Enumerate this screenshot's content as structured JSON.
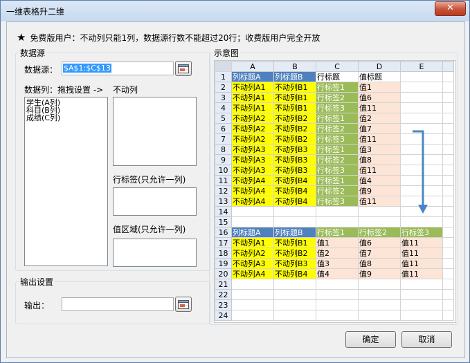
{
  "window": {
    "title": "一维表格升二维",
    "close_label": "✕"
  },
  "notice": {
    "icon": "star-icon",
    "text": "免费版用户：不动列只能1列，数据源行数不能超过20行；收费版用户完全开放"
  },
  "datasource": {
    "legend": "数据源",
    "source_label": "数据源：",
    "source_value": "$A$1:$C$13",
    "columns_label": "数据列：拖拽设置 ->",
    "columns": [
      "学生(A列)",
      "科目(B列)",
      "成绩(C列)"
    ],
    "fixed_label": "不动列",
    "rowtag_label": "行标签(只允许一列)",
    "value_label": "值区域(只允许一列)"
  },
  "output": {
    "legend": "输出设置",
    "label": "输出：",
    "value": ""
  },
  "diagram": {
    "legend": "示意图",
    "col_headers": [
      "A",
      "B",
      "C",
      "D",
      "E"
    ],
    "rows": [
      {
        "n": "1",
        "cells": [
          {
            "t": "列标题A",
            "c": "bh"
          },
          {
            "t": "列标题B",
            "c": "bh"
          },
          {
            "t": "行标题",
            "c": ""
          },
          {
            "t": "值标题",
            "c": ""
          },
          {
            "t": "",
            "c": ""
          }
        ]
      },
      {
        "n": "2",
        "cells": [
          {
            "t": "不动列A1",
            "c": "y"
          },
          {
            "t": "不动列B1",
            "c": "y"
          },
          {
            "t": "行标签1",
            "c": "g"
          },
          {
            "t": "值1",
            "c": "p"
          },
          {
            "t": "",
            "c": ""
          }
        ]
      },
      {
        "n": "3",
        "cells": [
          {
            "t": "不动列A1",
            "c": "y"
          },
          {
            "t": "不动列B1",
            "c": "y"
          },
          {
            "t": "行标签2",
            "c": "g"
          },
          {
            "t": "值6",
            "c": "p"
          },
          {
            "t": "",
            "c": ""
          }
        ]
      },
      {
        "n": "4",
        "cells": [
          {
            "t": "不动列A1",
            "c": "y"
          },
          {
            "t": "不动列B1",
            "c": "y"
          },
          {
            "t": "行标签3",
            "c": "g"
          },
          {
            "t": "值11",
            "c": "p"
          },
          {
            "t": "",
            "c": ""
          }
        ]
      },
      {
        "n": "5",
        "cells": [
          {
            "t": "不动列A2",
            "c": "y"
          },
          {
            "t": "不动列B2",
            "c": "y"
          },
          {
            "t": "行标签1",
            "c": "g"
          },
          {
            "t": "值2",
            "c": "p"
          },
          {
            "t": "",
            "c": ""
          }
        ]
      },
      {
        "n": "6",
        "cells": [
          {
            "t": "不动列A2",
            "c": "y"
          },
          {
            "t": "不动列B2",
            "c": "y"
          },
          {
            "t": "行标签2",
            "c": "g"
          },
          {
            "t": "值7",
            "c": "p"
          },
          {
            "t": "",
            "c": ""
          }
        ]
      },
      {
        "n": "7",
        "cells": [
          {
            "t": "不动列A2",
            "c": "y"
          },
          {
            "t": "不动列B2",
            "c": "y"
          },
          {
            "t": "行标签3",
            "c": "g"
          },
          {
            "t": "值11",
            "c": "p"
          },
          {
            "t": "",
            "c": ""
          }
        ]
      },
      {
        "n": "8",
        "cells": [
          {
            "t": "不动列A3",
            "c": "y"
          },
          {
            "t": "不动列B3",
            "c": "y"
          },
          {
            "t": "行标签1",
            "c": "g"
          },
          {
            "t": "值3",
            "c": "p"
          },
          {
            "t": "",
            "c": ""
          }
        ]
      },
      {
        "n": "9",
        "cells": [
          {
            "t": "不动列A3",
            "c": "y"
          },
          {
            "t": "不动列B3",
            "c": "y"
          },
          {
            "t": "行标签2",
            "c": "g"
          },
          {
            "t": "值8",
            "c": "p"
          },
          {
            "t": "",
            "c": ""
          }
        ]
      },
      {
        "n": "10",
        "cells": [
          {
            "t": "不动列A3",
            "c": "y"
          },
          {
            "t": "不动列B3",
            "c": "y"
          },
          {
            "t": "行标签3",
            "c": "g"
          },
          {
            "t": "值11",
            "c": "p"
          },
          {
            "t": "",
            "c": ""
          }
        ]
      },
      {
        "n": "11",
        "cells": [
          {
            "t": "不动列A4",
            "c": "y"
          },
          {
            "t": "不动列B4",
            "c": "y"
          },
          {
            "t": "行标签1",
            "c": "g"
          },
          {
            "t": "值4",
            "c": "p"
          },
          {
            "t": "",
            "c": ""
          }
        ]
      },
      {
        "n": "12",
        "cells": [
          {
            "t": "不动列A4",
            "c": "y"
          },
          {
            "t": "不动列B4",
            "c": "y"
          },
          {
            "t": "行标签2",
            "c": "g"
          },
          {
            "t": "值9",
            "c": "p"
          },
          {
            "t": "",
            "c": ""
          }
        ]
      },
      {
        "n": "13",
        "cells": [
          {
            "t": "不动列A4",
            "c": "y"
          },
          {
            "t": "不动列B4",
            "c": "y"
          },
          {
            "t": "行标签3",
            "c": "g"
          },
          {
            "t": "值11",
            "c": "p"
          },
          {
            "t": "",
            "c": ""
          }
        ]
      },
      {
        "n": "14",
        "cells": [
          {
            "t": "",
            "c": ""
          },
          {
            "t": "",
            "c": ""
          },
          {
            "t": "",
            "c": ""
          },
          {
            "t": "",
            "c": ""
          },
          {
            "t": "",
            "c": ""
          }
        ]
      },
      {
        "n": "15",
        "cells": [
          {
            "t": "",
            "c": ""
          },
          {
            "t": "",
            "c": ""
          },
          {
            "t": "",
            "c": ""
          },
          {
            "t": "",
            "c": ""
          },
          {
            "t": "",
            "c": ""
          }
        ]
      },
      {
        "n": "16",
        "cells": [
          {
            "t": "列标题A",
            "c": "bh"
          },
          {
            "t": "列标题B",
            "c": "bh"
          },
          {
            "t": "行标签1",
            "c": "gh"
          },
          {
            "t": "行标签2",
            "c": "gh"
          },
          {
            "t": "行标签3",
            "c": "gh"
          }
        ]
      },
      {
        "n": "17",
        "cells": [
          {
            "t": "不动列A1",
            "c": "y"
          },
          {
            "t": "不动列B1",
            "c": "y"
          },
          {
            "t": "值1",
            "c": "p"
          },
          {
            "t": "值6",
            "c": "p"
          },
          {
            "t": "值11",
            "c": "p"
          }
        ]
      },
      {
        "n": "18",
        "cells": [
          {
            "t": "不动列A2",
            "c": "y"
          },
          {
            "t": "不动列B2",
            "c": "y"
          },
          {
            "t": "值2",
            "c": "p"
          },
          {
            "t": "值7",
            "c": "p"
          },
          {
            "t": "值11",
            "c": "p"
          }
        ]
      },
      {
        "n": "19",
        "cells": [
          {
            "t": "不动列A3",
            "c": "y"
          },
          {
            "t": "不动列B3",
            "c": "y"
          },
          {
            "t": "值3",
            "c": "p"
          },
          {
            "t": "值8",
            "c": "p"
          },
          {
            "t": "值11",
            "c": "p"
          }
        ]
      },
      {
        "n": "20",
        "cells": [
          {
            "t": "不动列A4",
            "c": "y"
          },
          {
            "t": "不动列B4",
            "c": "y"
          },
          {
            "t": "值4",
            "c": "p"
          },
          {
            "t": "值9",
            "c": "p"
          },
          {
            "t": "值11",
            "c": "p"
          }
        ]
      },
      {
        "n": "21",
        "cells": [
          {
            "t": "",
            "c": ""
          },
          {
            "t": "",
            "c": ""
          },
          {
            "t": "",
            "c": ""
          },
          {
            "t": "",
            "c": ""
          },
          {
            "t": "",
            "c": ""
          }
        ]
      },
      {
        "n": "22",
        "cells": [
          {
            "t": "",
            "c": ""
          },
          {
            "t": "",
            "c": ""
          },
          {
            "t": "",
            "c": ""
          },
          {
            "t": "",
            "c": ""
          },
          {
            "t": "",
            "c": ""
          }
        ]
      },
      {
        "n": "23",
        "cells": [
          {
            "t": "",
            "c": ""
          },
          {
            "t": "",
            "c": ""
          },
          {
            "t": "",
            "c": ""
          },
          {
            "t": "",
            "c": ""
          },
          {
            "t": "",
            "c": ""
          }
        ]
      },
      {
        "n": "24",
        "cells": [
          {
            "t": "",
            "c": ""
          },
          {
            "t": "",
            "c": ""
          },
          {
            "t": "",
            "c": ""
          },
          {
            "t": "",
            "c": ""
          },
          {
            "t": "",
            "c": ""
          }
        ]
      }
    ],
    "arrow_color": "#4a86c5"
  },
  "buttons": {
    "ok": "确定",
    "cancel": "取消"
  }
}
